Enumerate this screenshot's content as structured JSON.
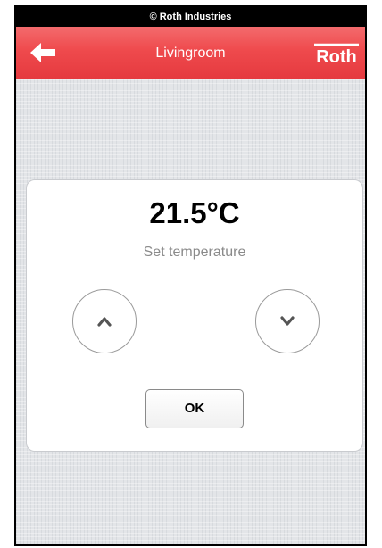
{
  "status_bar": {
    "text": "© Roth Industries"
  },
  "header": {
    "title": "Livingroom",
    "back_icon": "arrow-left-icon",
    "logo_text": "Roth",
    "color": "#ef4a4d"
  },
  "setpoint": {
    "value": "21.5°C",
    "label": "Set temperature",
    "increase_icon": "chevron-up-icon",
    "decrease_icon": "chevron-down-icon",
    "ok_label": "OK"
  }
}
